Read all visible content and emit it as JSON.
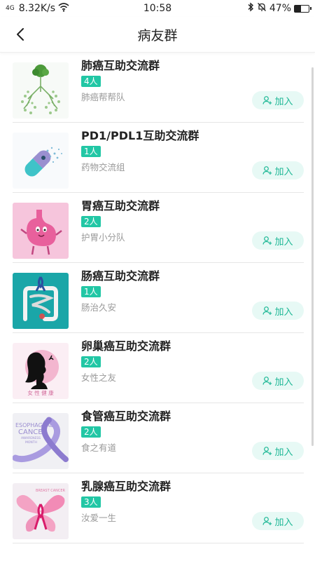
{
  "status_bar": {
    "signal": "4G",
    "net_speed": "8.32K/s",
    "time": "10:58",
    "battery": "47%",
    "battery_level": 0.47
  },
  "header": {
    "title": "病友群"
  },
  "join_label": "加入",
  "groups": [
    {
      "name": "肺癌互助交流群",
      "count": "4人",
      "subtitle": "肺癌帮帮队",
      "icon": "lung-tree-icon"
    },
    {
      "name": "PD1/PDL1互助交流群",
      "count": "1人",
      "subtitle": "药物交流组",
      "icon": "capsule-icon"
    },
    {
      "name": "胃癌互助交流群",
      "count": "2人",
      "subtitle": "护胃小分队",
      "icon": "stomach-icon"
    },
    {
      "name": "肠癌互助交流群",
      "count": "1人",
      "subtitle": "肠治久安",
      "icon": "intestine-icon"
    },
    {
      "name": "卵巢癌互助交流群",
      "count": "2人",
      "subtitle": "女性之友",
      "icon": "woman-silhouette-icon",
      "thumb_text": "女 性 健 康"
    },
    {
      "name": "食管癌互助交流群",
      "count": "2人",
      "subtitle": "食之有道",
      "icon": "awareness-ribbon-icon",
      "thumb_text": [
        "ESOPHAGEAL",
        "CANCER",
        "AWARENESS",
        "MONTH"
      ]
    },
    {
      "name": "乳腺癌互助交流群",
      "count": "3人",
      "subtitle": "汝爱一生",
      "icon": "butterfly-ribbon-icon",
      "thumb_text": "BREAST CANCER"
    }
  ]
}
